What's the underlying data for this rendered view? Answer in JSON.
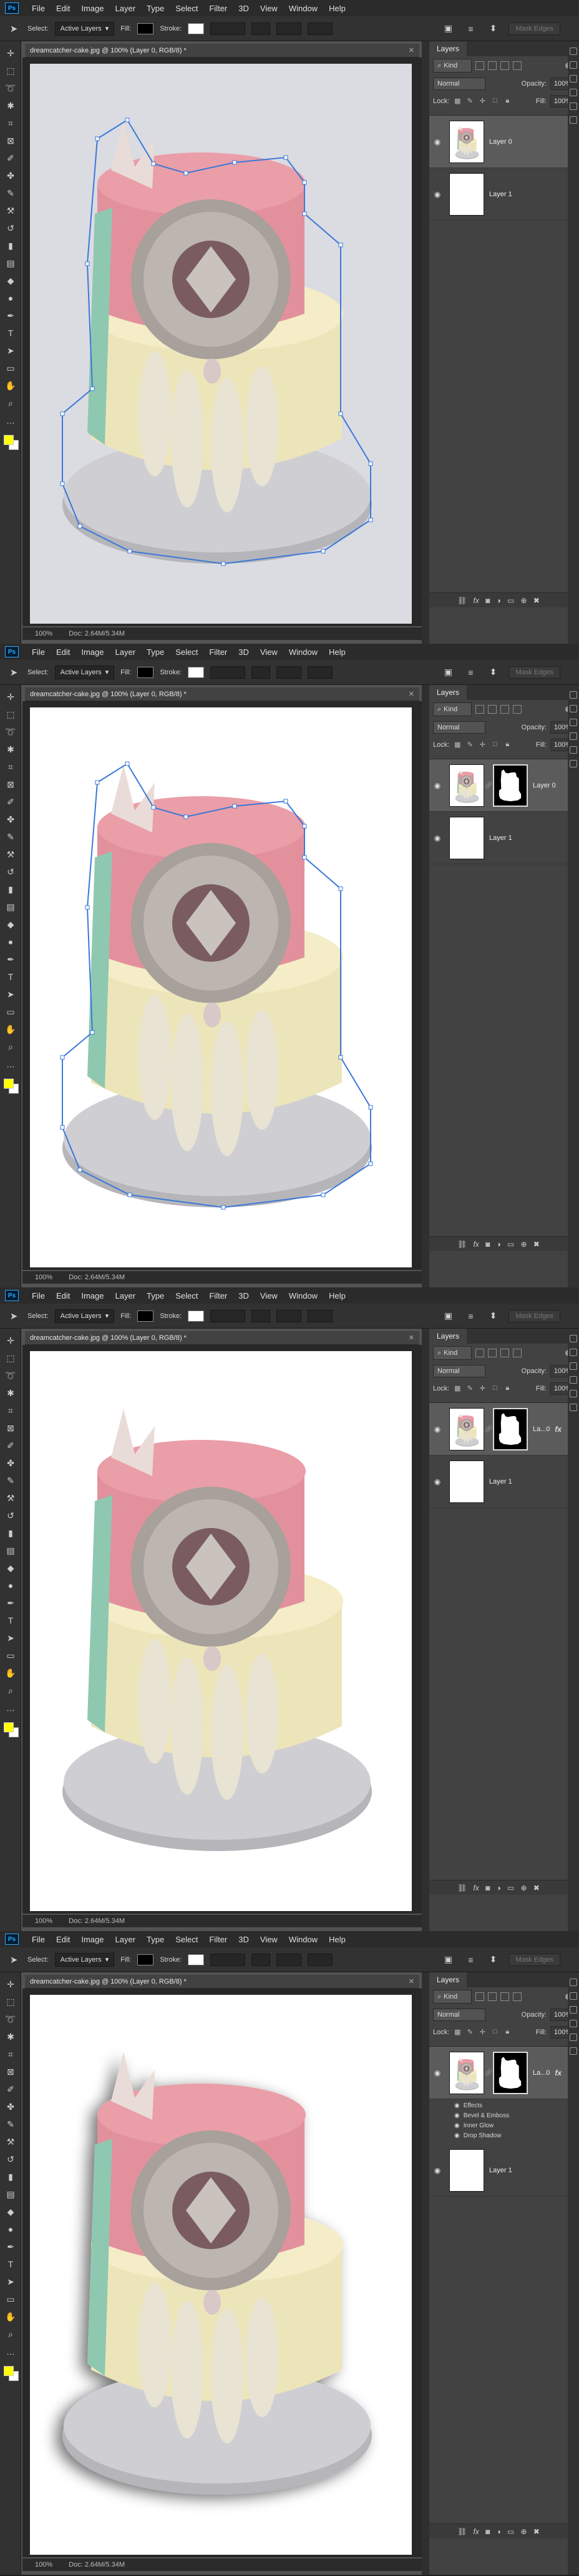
{
  "menu": [
    "File",
    "Edit",
    "Image",
    "Layer",
    "Type",
    "Select",
    "Filter",
    "3D",
    "View",
    "Window",
    "Help"
  ],
  "logo": "Ps",
  "options": {
    "select_label": "Select:",
    "select_value": "Active Layers",
    "fill_label": "Fill:",
    "stroke_label": "Stroke:",
    "mask_button": "Mask Edges"
  },
  "document": {
    "tab_title": "dreamcatcher-cake.jpg @ 100% (Layer 0, RGB/8) *",
    "zoom": "100%",
    "doc_info": "Doc: 2.64M/5.34M"
  },
  "layers_panel": {
    "tab": "Layers",
    "kind": "Kind",
    "blend": "Normal",
    "opacity_label": "Opacity:",
    "opacity": "100%",
    "lock_label": "Lock:",
    "fill_label": "Fill:",
    "fill": "100%"
  },
  "frames": [
    {
      "layer0_name": "Layer 0",
      "layer1_name": "Layer 1",
      "has_mask": false,
      "has_fx": false,
      "show_effects": false,
      "bg": "#dbdbe2"
    },
    {
      "layer0_name": "Layer 0",
      "layer1_name": "Layer 1",
      "has_mask": true,
      "has_fx": false,
      "show_effects": false,
      "bg": "#ffffff"
    },
    {
      "layer0_name": "La...0",
      "layer1_name": "Layer 1",
      "has_mask": true,
      "has_fx": true,
      "show_effects": false,
      "bg": "#ffffff"
    },
    {
      "layer0_name": "La...0",
      "layer1_name": "Layer 1",
      "has_mask": true,
      "has_fx": true,
      "show_effects": true,
      "bg": "#ffffff"
    }
  ],
  "effects_list": {
    "header": "Effects",
    "items": [
      "Bevel & Emboss",
      "Inner Glow",
      "Drop Shadow"
    ]
  },
  "colors": {
    "foreground": "#ffff00",
    "background": "#ffffff",
    "path": "#3a78d8",
    "cake_top": "#e0909a",
    "cake_bottom": "#ede5ba",
    "board": "#c4c4c8"
  },
  "icons": {
    "tools": [
      "move-icon",
      "marquee-icon",
      "lasso-icon",
      "quick-select-icon",
      "crop-icon",
      "frame-icon",
      "eyedropper-icon",
      "healing-icon",
      "brush-icon",
      "stamp-icon",
      "history-brush-icon",
      "eraser-icon",
      "gradient-icon",
      "blur-icon",
      "dodge-icon",
      "pen-icon",
      "type-icon",
      "path-select-icon",
      "shape-icon",
      "hand-icon",
      "zoom-icon",
      "more-icon"
    ],
    "footer": [
      "link-icon",
      "fx-icon",
      "mask-icon",
      "adjustment-icon",
      "folder-icon",
      "new-layer-icon",
      "trash-icon"
    ]
  }
}
